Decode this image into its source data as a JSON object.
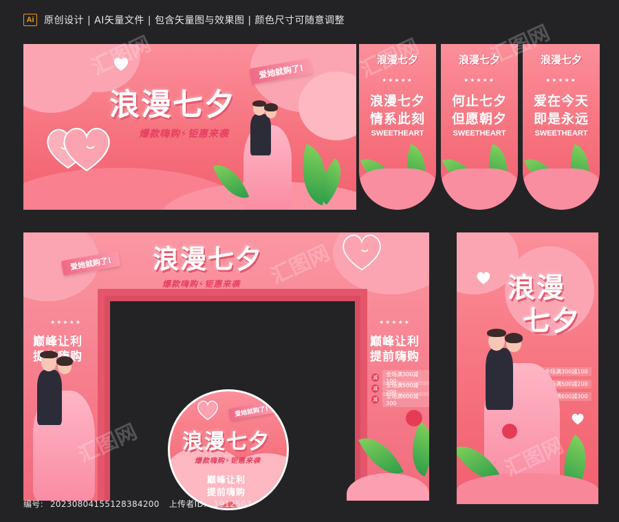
{
  "header": {
    "badge": "Ai",
    "text": "原创设计 | AI矢量文件 | 包含矢量图与效果图 | 颜色尺寸可随意调整"
  },
  "banner": {
    "title": "浪漫七夕",
    "subtitle": "爆款嗨购⚡钜惠来袭",
    "ribbon": "爱她就购了!"
  },
  "signs": [
    {
      "logo": "浪漫七夕",
      "line1": "浪漫七夕",
      "line2": "情系此刻",
      "en": "SWEETHEART"
    },
    {
      "logo": "浪漫七夕",
      "line1": "何止七夕",
      "line2": "但愿朝夕",
      "en": "SWEETHEART"
    },
    {
      "logo": "浪漫七夕",
      "line1": "爱在今天",
      "line2": "即是永远",
      "en": "SWEETHEART"
    }
  ],
  "arch": {
    "title": "浪漫七夕",
    "subtitle": "爆款嗨购⚡钜惠来袭",
    "ribbon": "爱她就购了!",
    "left_line1": "巅峰让利",
    "left_line2": "提前嗨购",
    "right_line1": "巅峰让利",
    "right_line2": "提前嗨购",
    "promos": [
      {
        "tag": "减",
        "text": "全场满300减100"
      },
      {
        "tag": "减",
        "text": "全场满500减200"
      },
      {
        "tag": "减",
        "text": "全场满600减300"
      }
    ]
  },
  "circle": {
    "title": "浪漫七夕",
    "subtitle": "爆款嗨购⚡钜惠来袭",
    "ribbon": "爱她就购了!",
    "line1": "巅峰让利",
    "line2": "提前嗨购"
  },
  "rollup": {
    "title_a": "浪漫",
    "title_b": "七夕",
    "promos": [
      {
        "tag": "减",
        "text": "全场满300减100"
      },
      {
        "tag": "减",
        "text": "全场满500减200"
      },
      {
        "tag": "减",
        "text": "全场满600减300"
      }
    ]
  },
  "footer": {
    "id_label": "编号:",
    "id_value": "20230804155128384200",
    "uploader_label": "上传者ID:",
    "uploader_value": "1912507"
  },
  "watermark": "汇图网",
  "colors": {
    "pink": "#f6727e",
    "deep": "#e5566b",
    "bg": "#232326",
    "accent": "#f29a1c"
  }
}
